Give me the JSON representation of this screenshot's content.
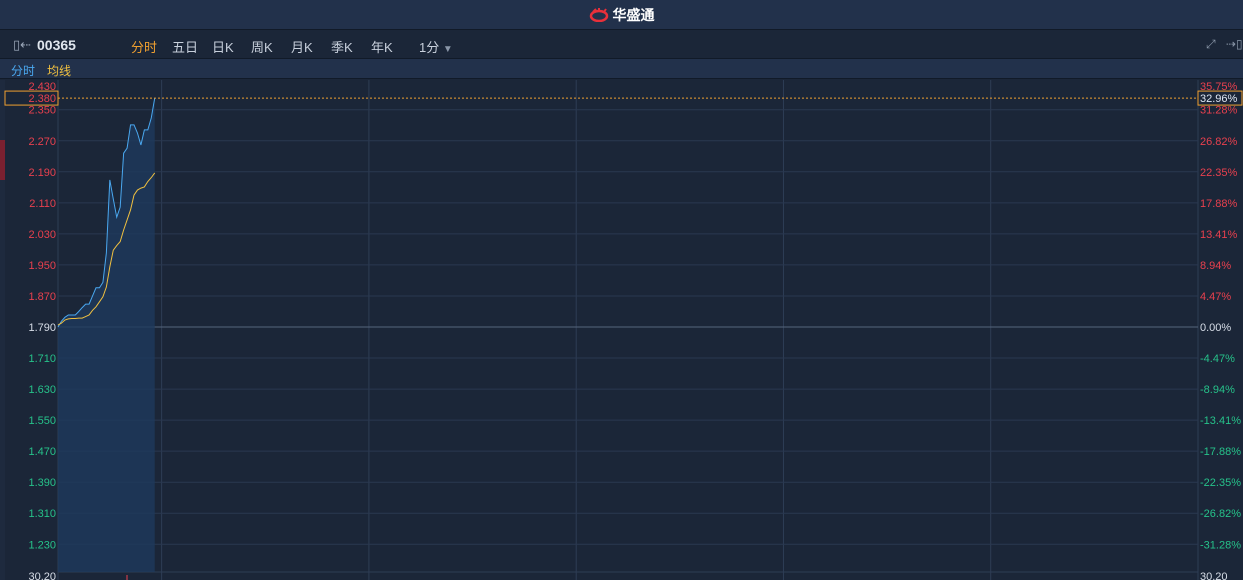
{
  "app": {
    "title": "华盛通",
    "logo_icon": "huashengtong-logo"
  },
  "toolbar": {
    "code": "00365",
    "tabs": [
      {
        "label": "分时",
        "active": true
      },
      {
        "label": "五日"
      },
      {
        "label": "日K"
      },
      {
        "label": "周K"
      },
      {
        "label": "月K"
      },
      {
        "label": "季K"
      },
      {
        "label": "年K"
      }
    ],
    "interval": "1分"
  },
  "legend": {
    "price": "分时",
    "avg": "均线"
  },
  "colors": {
    "up": "#e8404e",
    "down": "#26c28a",
    "price_line": "#4aa8f0",
    "avg_line": "#f0c040",
    "accent": "#f0a030"
  },
  "chart_data": {
    "type": "line",
    "base_price": 1.79,
    "ylim": [
      1.15,
      2.43
    ],
    "total_minutes": 330,
    "cursor": {
      "price": "2.380",
      "percent": "32.96%"
    },
    "price_ticks": [
      "2.430",
      "2.350",
      "2.270",
      "2.190",
      "2.110",
      "2.030",
      "1.950",
      "1.870",
      "1.790",
      "1.710",
      "1.630",
      "1.550",
      "1.470",
      "1.390",
      "1.310",
      "1.230"
    ],
    "percent_ticks": [
      "35.75%",
      "31.28%",
      "26.82%",
      "22.35%",
      "17.88%",
      "13.41%",
      "8.94%",
      "4.47%",
      "0.00%",
      "-4.47%",
      "-8.94%",
      "-13.41%",
      "-17.88%",
      "-22.35%",
      "-26.82%",
      "-31.28%"
    ],
    "volume_max_left": "30.20",
    "volume_max_right": "30.20",
    "series": [
      {
        "name": "分时",
        "values": [
          1.79,
          1.805,
          1.815,
          1.821,
          1.821,
          1.821,
          1.83,
          1.84,
          1.849,
          1.849,
          1.87,
          1.891,
          1.891,
          1.905,
          1.981,
          2.169,
          2.12,
          2.073,
          2.099,
          2.238,
          2.251,
          2.311,
          2.311,
          2.29,
          2.259,
          2.298,
          2.298,
          2.329,
          2.38
        ]
      },
      {
        "name": "均线",
        "values": [
          1.795,
          1.8,
          1.808,
          1.811,
          1.812,
          1.812,
          1.813,
          1.813,
          1.817,
          1.821,
          1.833,
          1.842,
          1.855,
          1.868,
          1.893,
          1.945,
          1.988,
          2.0,
          2.01,
          2.04,
          2.066,
          2.092,
          2.13,
          2.143,
          2.148,
          2.151,
          2.165,
          2.175,
          2.187
        ]
      }
    ]
  }
}
